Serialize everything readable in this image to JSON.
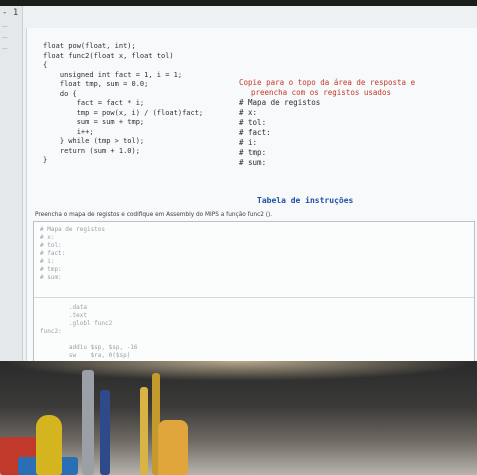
{
  "sidebar": {
    "number": "- 1",
    "lines": [
      "...",
      "...",
      "..."
    ]
  },
  "code_lines": [
    "float pow(float, int);",
    "float func2(float x, float tol)",
    "{",
    "    unsigned int fact = 1, i = 1;",
    "    float tmp, sum = 0.0;",
    "    do {",
    "        fact = fact * i;",
    "        tmp = pow(x, i) / (float)fact;",
    "        sum = sum + tmp;",
    "        i++;",
    "    } while (tmp > tol);",
    "    return (sum + 1.0);",
    "}"
  ],
  "instructions": {
    "line1": "Copie para o topo da área de resposta e",
    "line2": "preencha com os registos usados",
    "registers": [
      "# Mapa de registos",
      "# x:",
      "# tol:",
      "# fact:",
      "# i:",
      "# tmp:",
      "# sum:"
    ]
  },
  "table_title": "Tabela de instruções",
  "prompt": "Preencha o mapa de registos e codifique em Assembly do MIPS a função func2 ().",
  "answer": {
    "top": "# Mapa de registos\n# x:\n# tol:\n# fact:\n# i:\n# tmp:\n# sum:",
    "bottom": "        .data\n        .text\n        .globl func2\nfunc2:\n\n        addiu $sp, $sp, -16\n        sw    $ra, 0($sp)\n        ..."
  }
}
